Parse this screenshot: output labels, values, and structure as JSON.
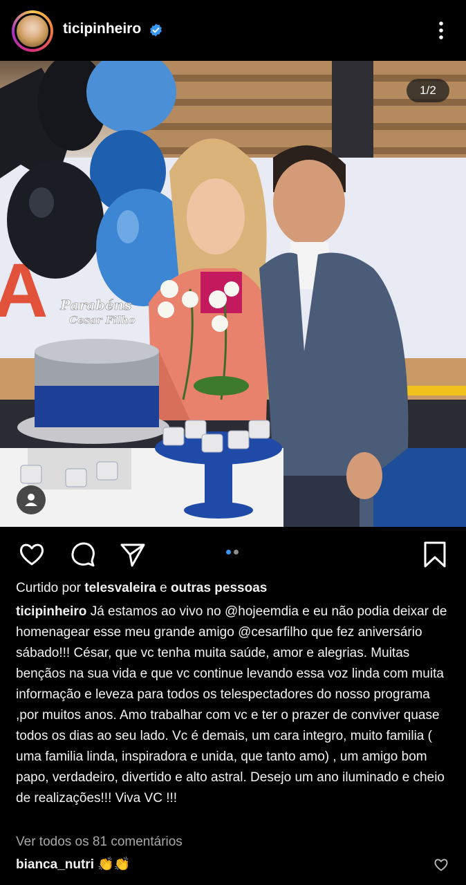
{
  "post": {
    "username": "ticipinheiro",
    "slide_counter": "1/2",
    "slides_total": 2,
    "active_slide": 1
  },
  "photo": {
    "cake_topper_line1": "Parabéns",
    "cake_topper_line2": "Cesar Filho"
  },
  "likes": {
    "prefix": "Curtido por ",
    "user": "telesvaleira",
    "middle": " e ",
    "others": "outras pessoas"
  },
  "caption": {
    "username": "ticipinheiro",
    "text": "Já estamos ao vivo no @hojeemdia e eu não podia deixar de homenagear esse meu grande amigo @cesarfilho que fez aniversário sábado!!! César, que vc tenha muita saúde, amor e alegrias. Muitas bençãos na sua vida e que vc continue levando essa voz linda com muita informação e leveza para todos os telespectadores do nosso programa ,por muitos anos. Amo trabalhar com vc e ter o prazer de conviver quase todos os dias ao seu lado. Vc é demais, um cara integro, muito familia ( uma familia linda, inspiradora e unida, que tanto amo) , um amigo bom papo, verdadeiro, divertido e alto astral.  Desejo um ano iluminado e cheio de realizações!!! Viva VC !!!"
  },
  "comments": {
    "view_all": "Ver todos os 81 comentários",
    "first_user": "bianca_nutri",
    "first_text": "👏👏"
  },
  "colors": {
    "background": "#000000",
    "verified_blue": "#3897f0",
    "dot_active": "#3897f0",
    "dot_inactive": "#8e8e8e",
    "muted_text": "#a8a8a8"
  },
  "icons": {
    "like": "heart-icon",
    "comment": "comment-bubble-icon",
    "share": "paper-plane-icon",
    "save": "bookmark-icon",
    "more": "more-vertical-icon",
    "verified": "verified-badge-icon",
    "tag": "user-tag-icon"
  }
}
